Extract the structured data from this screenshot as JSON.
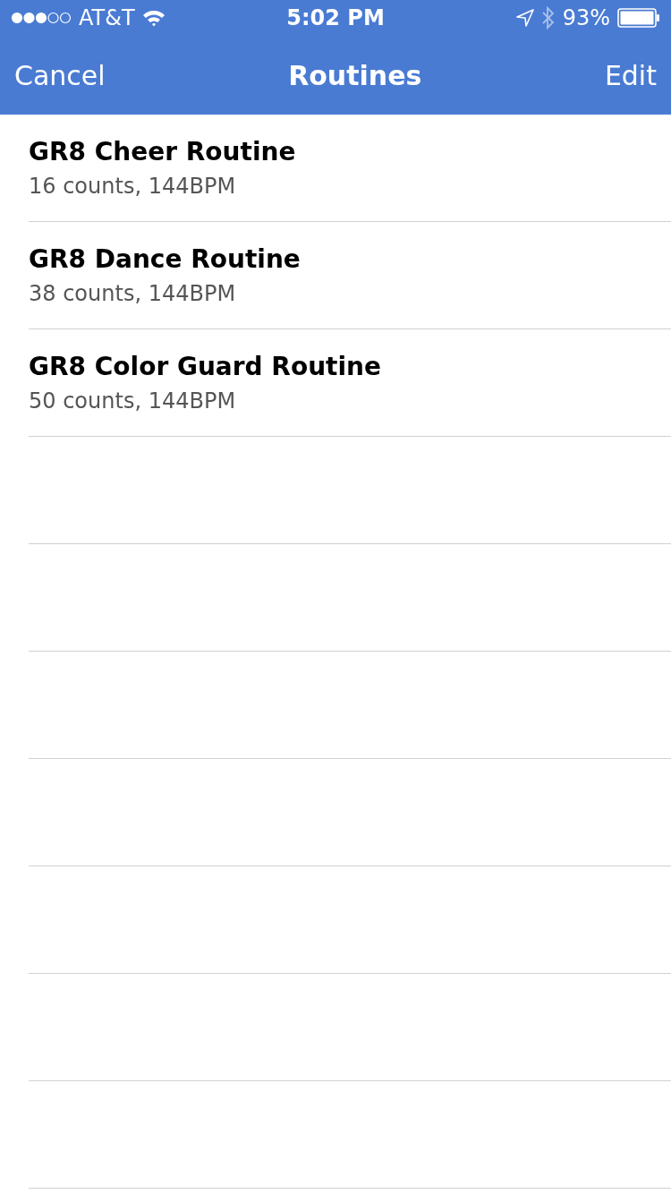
{
  "status_bar": {
    "carrier": "AT&T",
    "time": "5:02 PM",
    "battery": "93%"
  },
  "nav_bar": {
    "left": "Cancel",
    "title": "Routines",
    "right": "Edit"
  },
  "routines": [
    {
      "title": "GR8 Cheer Routine",
      "detail": "16 counts, 144BPM"
    },
    {
      "title": "GR8 Dance Routine",
      "detail": "38 counts, 144BPM"
    },
    {
      "title": "GR8 Color Guard Routine",
      "detail": "50 counts, 144BPM"
    }
  ]
}
